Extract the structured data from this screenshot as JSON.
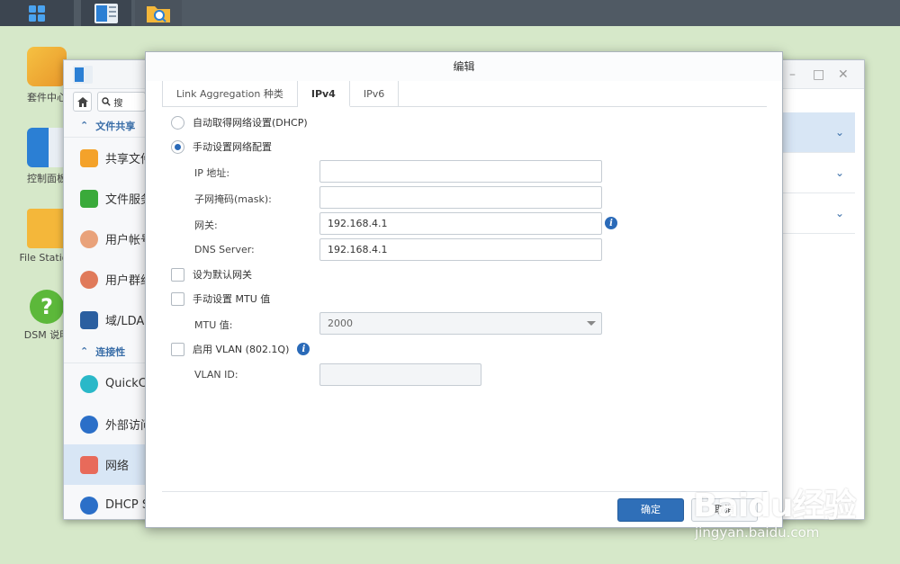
{
  "desktop": {
    "icons": [
      {
        "label": "套件中心"
      },
      {
        "label": "控制面板"
      },
      {
        "label": "File Station"
      },
      {
        "label": "DSM 说明"
      }
    ]
  },
  "control_panel": {
    "search_placeholder": "搜",
    "sidebar": {
      "section_file_sharing": "文件共享",
      "items_a": [
        {
          "label": "共享文件"
        },
        {
          "label": "文件服务"
        },
        {
          "label": "用户帐号"
        },
        {
          "label": "用户群组"
        },
        {
          "label": "域/LDAP"
        }
      ],
      "section_connectivity": "连接性",
      "items_b": [
        {
          "label": "QuickConnect"
        },
        {
          "label": "外部访问"
        },
        {
          "label": "网络"
        },
        {
          "label": "DHCP Server"
        }
      ]
    }
  },
  "dialog": {
    "title": "编辑",
    "tabs": [
      "Link Aggregation 种类",
      "IPv4",
      "IPv6"
    ],
    "active_tab": "IPv4",
    "radio_dhcp": "自动取得网络设置(DHCP)",
    "radio_manual": "手动设置网络配置",
    "ip_label": "IP 地址:",
    "ip_value": "",
    "mask_label": "子网掩码(mask):",
    "mask_value": "",
    "gateway_label": "网关:",
    "gateway_value": "192.168.4.1",
    "dns_label": "DNS Server:",
    "dns_value": "192.168.4.1",
    "default_gateway_label": "设为默认网关",
    "manual_mtu_label": "手动设置 MTU 值",
    "mtu_label": "MTU 值:",
    "mtu_value": "2000",
    "vlan_label": "启用 VLAN (802.1Q)",
    "vlan_id_label": "VLAN ID:",
    "vlan_id_value": "",
    "ok_label": "确定",
    "cancel_label": "取消"
  },
  "watermark": {
    "logo": "Baidu经验",
    "url": "jingyan.baidu.com"
  },
  "colors": {
    "accent": "#2f6fb8",
    "desktop_bg": "#d6e8c9",
    "taskbar": "#505a64"
  }
}
